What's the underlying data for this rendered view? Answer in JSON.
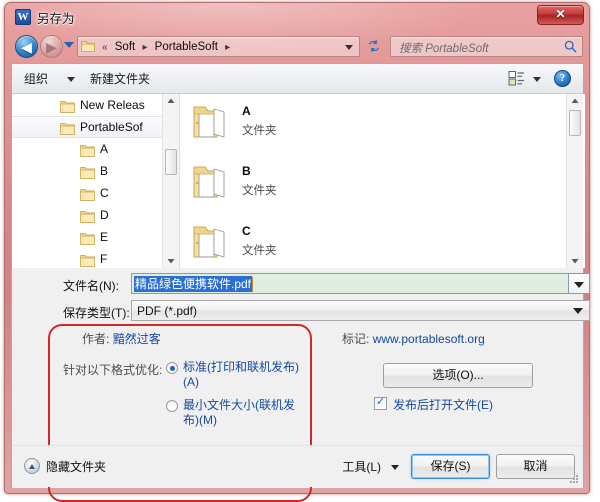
{
  "window": {
    "title": "另存为",
    "app_icon": "word-icon",
    "close_label": "✕"
  },
  "nav": {
    "back_icon": "back-arrow-icon",
    "back_glyph": "◀",
    "forward_icon": "forward-arrow-icon",
    "forward_glyph": "▶",
    "history_icon": "chevron-down-icon",
    "folder_icon": "folder-icon",
    "breadcrumb_prefix": "«",
    "breadcrumbs": [
      "Soft",
      "PortableSoft"
    ],
    "breadcrumb_separator": "▸",
    "refresh_icon": "refresh-icon",
    "search_placeholder": "搜索 PortableSoft",
    "search_icon": "search-icon"
  },
  "toolbar": {
    "organize_label": "组织",
    "organize_arrow_icon": "chevron-down-icon",
    "new_folder_label": "新建文件夹",
    "view_icon": "view-layout-icon",
    "view_arrow_icon": "chevron-down-icon",
    "help_icon": "help-icon",
    "help_glyph": "?"
  },
  "nav_pane": {
    "items": [
      {
        "label": "New Releas",
        "indent": 48,
        "selected": false
      },
      {
        "label": "PortableSof",
        "indent": 48,
        "selected": true
      },
      {
        "label": "A",
        "indent": 68,
        "selected": false
      },
      {
        "label": "B",
        "indent": 68,
        "selected": false
      },
      {
        "label": "C",
        "indent": 68,
        "selected": false
      },
      {
        "label": "D",
        "indent": 68,
        "selected": false
      },
      {
        "label": "E",
        "indent": 68,
        "selected": false
      },
      {
        "label": "F",
        "indent": 68,
        "selected": false
      }
    ],
    "scroll_up_icon": "scroll-up-icon",
    "scroll_down_icon": "scroll-down-icon"
  },
  "file_list": {
    "items": [
      {
        "name": "A",
        "type": "文件夹"
      },
      {
        "name": "B",
        "type": "文件夹"
      },
      {
        "name": "C",
        "type": "文件夹"
      }
    ],
    "scroll_up_icon": "scroll-up-icon",
    "scroll_down_icon": "scroll-down-icon"
  },
  "form": {
    "filename_label": "文件名(N):",
    "filename_value": "精品绿色便携软件.pdf",
    "filename_dropdown_icon": "chevron-down-icon",
    "savetype_label": "保存类型(T):",
    "savetype_value": "PDF (*.pdf)",
    "savetype_dropdown_icon": "chevron-down-icon",
    "author_label": "作者:",
    "author_value": "黯然过客",
    "tags_label": "标记:",
    "tags_value": "www.portablesoft.org",
    "optimize_label": "针对以下格式优化:",
    "optimize_standard": "标准(打印和联机发布)(A)",
    "optimize_minsize": "最小文件大小(联机发布)(M)",
    "optimize_selected": "standard",
    "options_button": "选项(O)...",
    "open_after_label": "发布后打开文件(E)",
    "open_after_checked": true
  },
  "bottom": {
    "hide_folders_label": "隐藏文件夹",
    "hide_folders_icon": "collapse-up-icon",
    "tools_label": "工具(L)",
    "tools_arrow_icon": "chevron-down-icon",
    "save_label": "保存(S)",
    "cancel_label": "取消",
    "resize_grip_icon": "resize-grip-icon"
  },
  "colors": {
    "annotation": "#cc2b2b",
    "link": "#14489e",
    "selection": "#2a6fd4",
    "filename_field_bg": "#dfeedf",
    "frame": "#d78a8a"
  }
}
